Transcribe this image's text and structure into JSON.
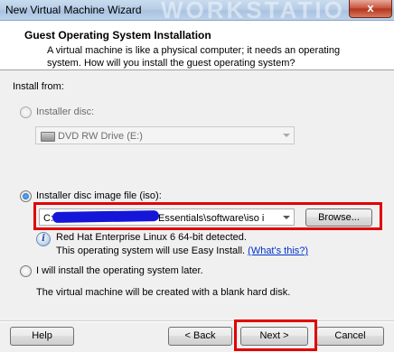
{
  "window": {
    "title": "New Virtual Machine Wizard",
    "watermark": "WORKSTATIO",
    "close_glyph": "x"
  },
  "header": {
    "title": "Guest Operating System Installation",
    "description": "A virtual machine is like a physical computer; it needs an operating system. How will you install the guest operating system?"
  },
  "install_from": {
    "label": "Install from:",
    "installer_disc": {
      "label": "Installer disc:",
      "selected": false,
      "drive_value": "DVD RW Drive (E:)"
    },
    "iso": {
      "label": "Installer disc image file (iso):",
      "selected": true,
      "path_prefix": "C:",
      "path_suffix": "Essentials\\software\\iso i",
      "browse_label": "Browse..."
    },
    "detection": {
      "info_glyph": "i",
      "detected_text": "Red Hat Enterprise Linux 6 64-bit detected.",
      "easy_install_text": "This operating system will use Easy Install.",
      "whats_this_link": "(What's this?)"
    },
    "later": {
      "label": "I will install the operating system later.",
      "selected": false,
      "description": "The virtual machine will be created with a blank hard disk."
    }
  },
  "footer": {
    "help_label": "Help",
    "back_label": "< Back",
    "next_label": "Next >",
    "cancel_label": "Cancel"
  },
  "colors": {
    "highlight_box": "#e00000",
    "redaction": "#1616d8",
    "link": "#0033cc"
  }
}
